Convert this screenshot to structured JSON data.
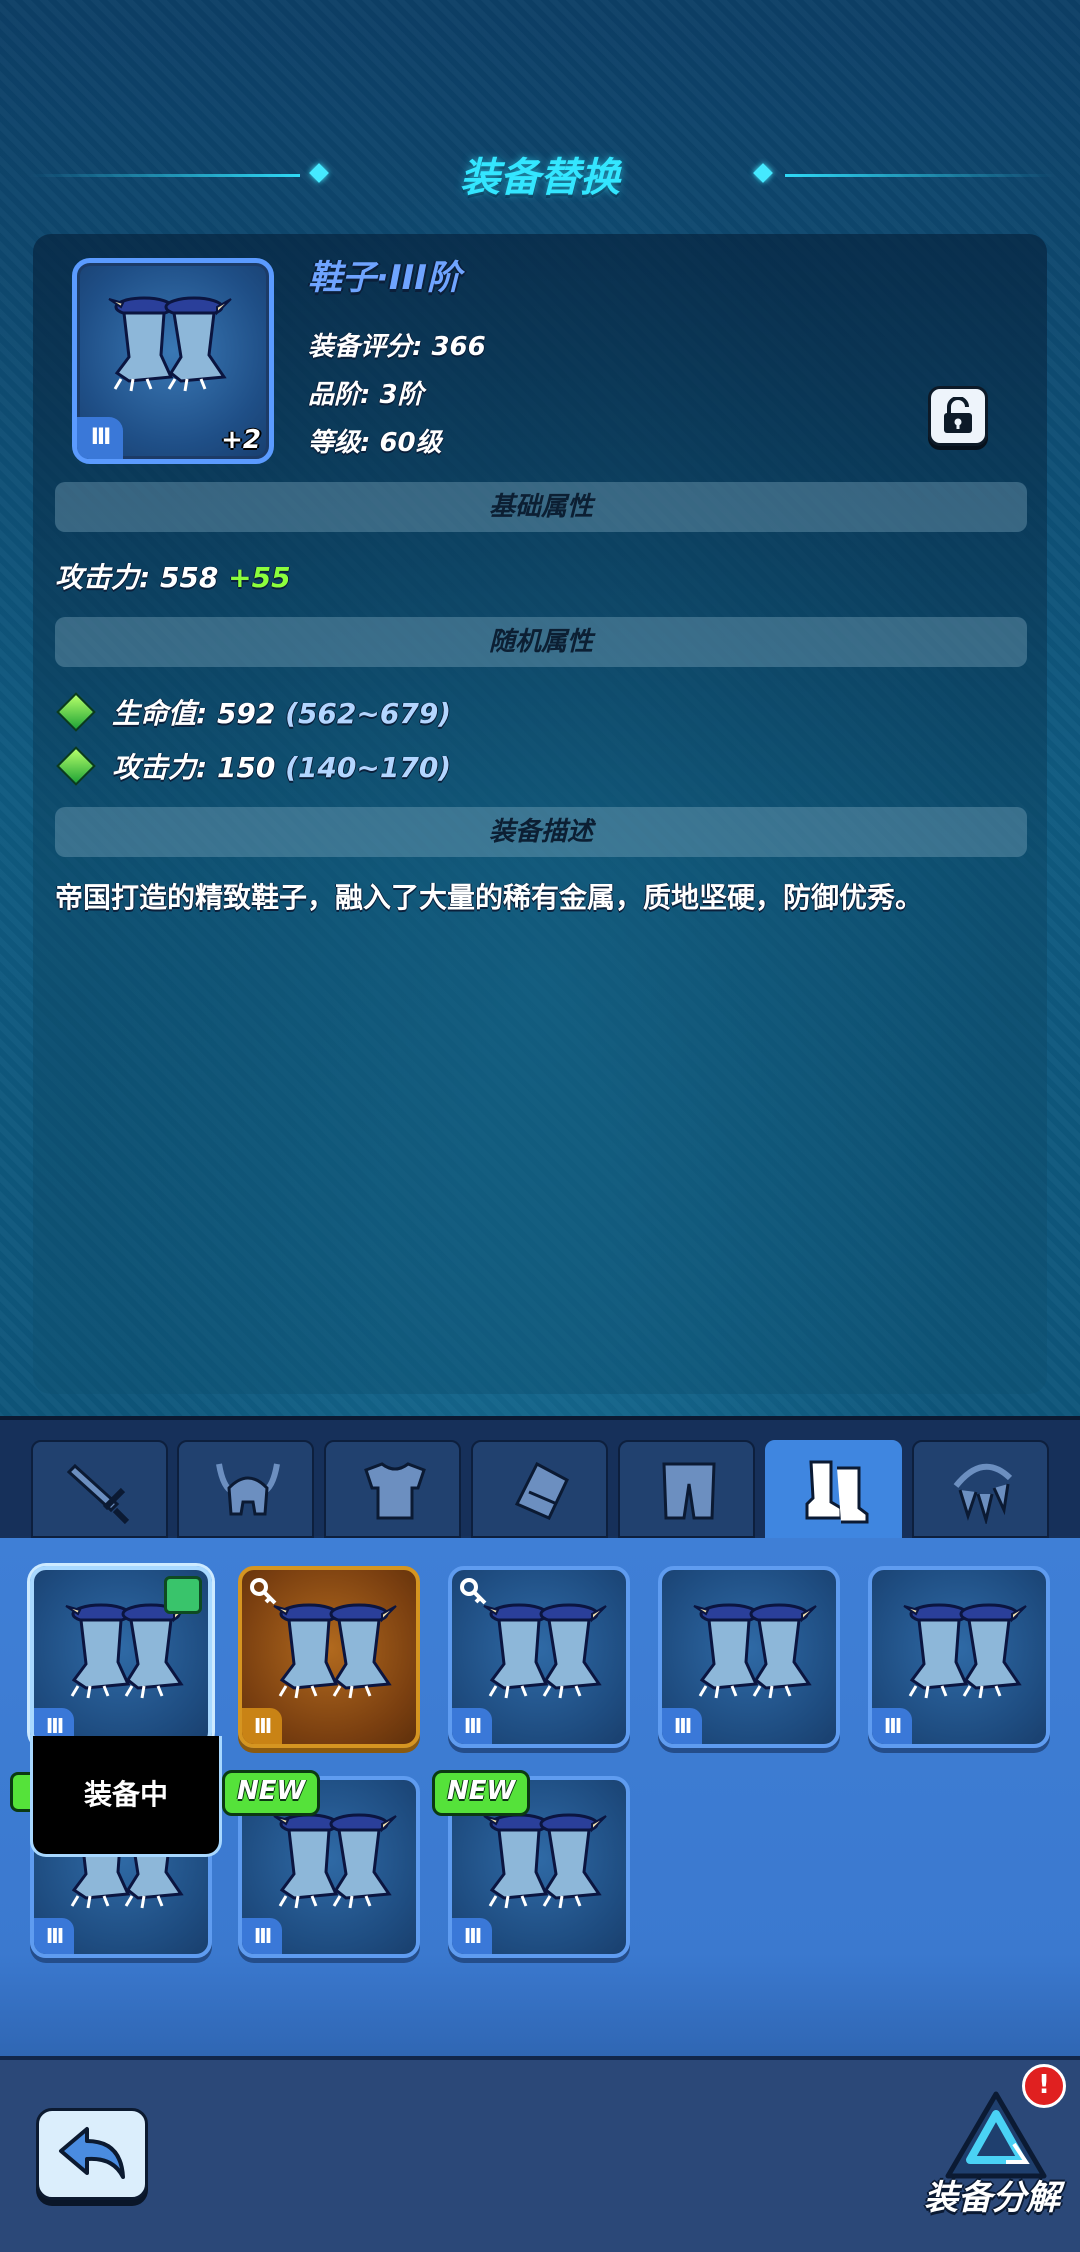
{
  "header": {
    "title": "装备替换"
  },
  "item": {
    "name": "鞋子·III阶",
    "tier_badge": "III",
    "enhance": "+2",
    "score": "装备评分: 366",
    "quality": "品阶: 3阶",
    "level": "等级: 60级"
  },
  "sections": {
    "base": "基础属性",
    "random": "随机属性",
    "desc": "装备描述"
  },
  "base_stat": {
    "label": "攻击力: 558",
    "bonus": "+55"
  },
  "random_stats": [
    {
      "label": "生命值: 592",
      "range": "(562~679)"
    },
    {
      "label": "攻击力: 150",
      "range": "(140~170)"
    }
  ],
  "description": "帝国打造的精致鞋子，融入了大量的稀有金属，质地坚硬，防御优秀。",
  "tabs": [
    "weapon-icon",
    "helmet-icon",
    "armor-icon",
    "bracer-icon",
    "pants-icon",
    "boots-icon",
    "necklace-icon"
  ],
  "active_tab": "boots-icon",
  "inventory": {
    "tier_label": "III",
    "equipped_label": "装备中",
    "new_label": "NEW"
  },
  "bottom": {
    "decompose_label": "装备分解",
    "alert": "!"
  },
  "colors": {
    "title_cyan": "#33e6ff",
    "item_name_blue": "#6fa4ff",
    "bonus_green": "#8cff3c",
    "new_green": "#55e23a",
    "gold_frame": "#d59521"
  }
}
